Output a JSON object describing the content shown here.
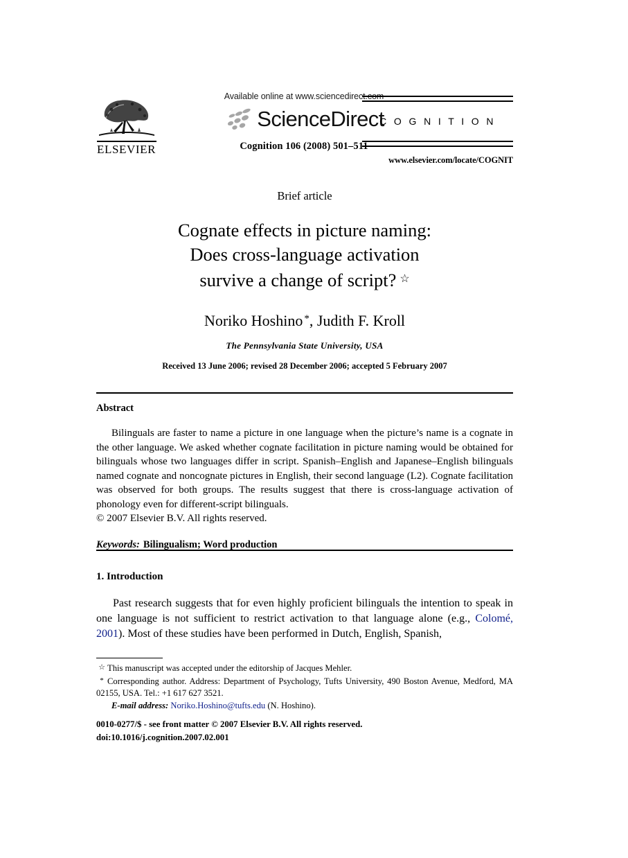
{
  "masthead": {
    "available_online": "Available online at www.sciencedirect.com",
    "sciencedirect_wordmark": "ScienceDirect",
    "citation": "Cognition 106 (2008) 501–511",
    "publisher": "ELSEVIER",
    "journal_name": "C O G N I T I O N",
    "journal_url": "www.elsevier.com/locate/COGNIT"
  },
  "title_block": {
    "article_type": "Brief article",
    "title_line1": "Cognate effects in picture naming:",
    "title_line2": "Does cross-language activation",
    "title_line3": "survive a change of script?",
    "title_footnote_marker": "☆",
    "authors": "Noriko Hoshino",
    "author_footnote_marker": "*",
    "authors_rest": ", Judith F. Kroll",
    "affiliation": "The Pennsylvania State University, USA",
    "history": "Received 13 June 2006; revised 28 December 2006; accepted 5 February 2007"
  },
  "abstract": {
    "heading": "Abstract",
    "body": "Bilinguals are faster to name a picture in one language when the picture’s name is a cognate in the other language. We asked whether cognate facilitation in picture naming would be obtained for bilinguals whose two languages differ in script. Spanish–English and Japanese–English bilinguals named cognate and noncognate pictures in English, their second language (L2). Cognate facilitation was observed for both groups. The results suggest that there is cross-language activation of phonology even for different-script bilinguals.",
    "copyright": "© 2007 Elsevier B.V. All rights reserved.",
    "keywords_label": "Keywords:",
    "keywords_values": "Bilingualism; Word production"
  },
  "introduction": {
    "heading": "1. Introduction",
    "body_part1": "Past research suggests that for even highly proficient bilinguals the intention to speak in one language is not sufficient to restrict activation to that language alone (e.g., ",
    "reference_link": "Colomé, 2001",
    "body_part2": "). Most of these studies have been performed in Dutch, English, Spanish,"
  },
  "footnotes": {
    "marker_star": "☆",
    "note_star": "This manuscript was accepted under the editorship of Jacques Mehler.",
    "marker_asterisk": "*",
    "note_corresponding": "Corresponding author. Address: Department of Psychology, Tufts University, 490 Boston Avenue, Medford, MA 02155, USA. Tel.: +1 617 627 3521.",
    "email_label": "E-mail address:",
    "email_value": "Noriko.Hoshino@tufts.edu",
    "email_suffix": "(N. Hoshino)."
  },
  "imprint": {
    "issn_line": "0010-0277/$ - see front matter © 2007 Elsevier B.V. All rights reserved.",
    "doi_line": "doi:10.1016/j.cognition.2007.02.001"
  },
  "colors": {
    "link": "#11218b",
    "text": "#000000",
    "swoosh_gray": "#9a9a9a"
  }
}
